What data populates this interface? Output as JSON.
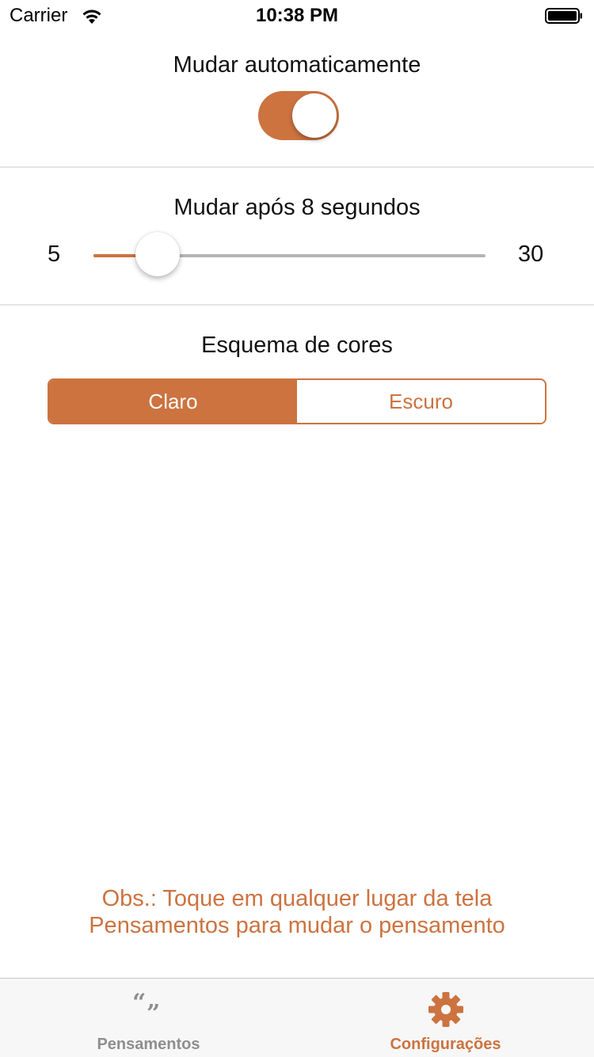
{
  "colors": {
    "accent": "#CC7340"
  },
  "status_bar": {
    "carrier": "Carrier",
    "time": "10:38 PM"
  },
  "auto_change": {
    "label": "Mudar automaticamente",
    "enabled": true
  },
  "interval": {
    "label": "Mudar após 8 segundos",
    "min_label": "5",
    "max_label": "30",
    "min": 5,
    "max": 30,
    "value": 8
  },
  "color_scheme": {
    "label": "Esquema de cores",
    "options": [
      "Claro",
      "Escuro"
    ],
    "selected": "Claro"
  },
  "note": {
    "line1": "Obs.: Toque em qualquer lugar da tela",
    "line2": "Pensamentos para mudar o pensamento"
  },
  "tab_bar": {
    "tabs": [
      {
        "label": "Pensamentos",
        "icon": "quote-icon",
        "active": false
      },
      {
        "label": "Configurações",
        "icon": "gear-icon",
        "active": true
      }
    ]
  }
}
